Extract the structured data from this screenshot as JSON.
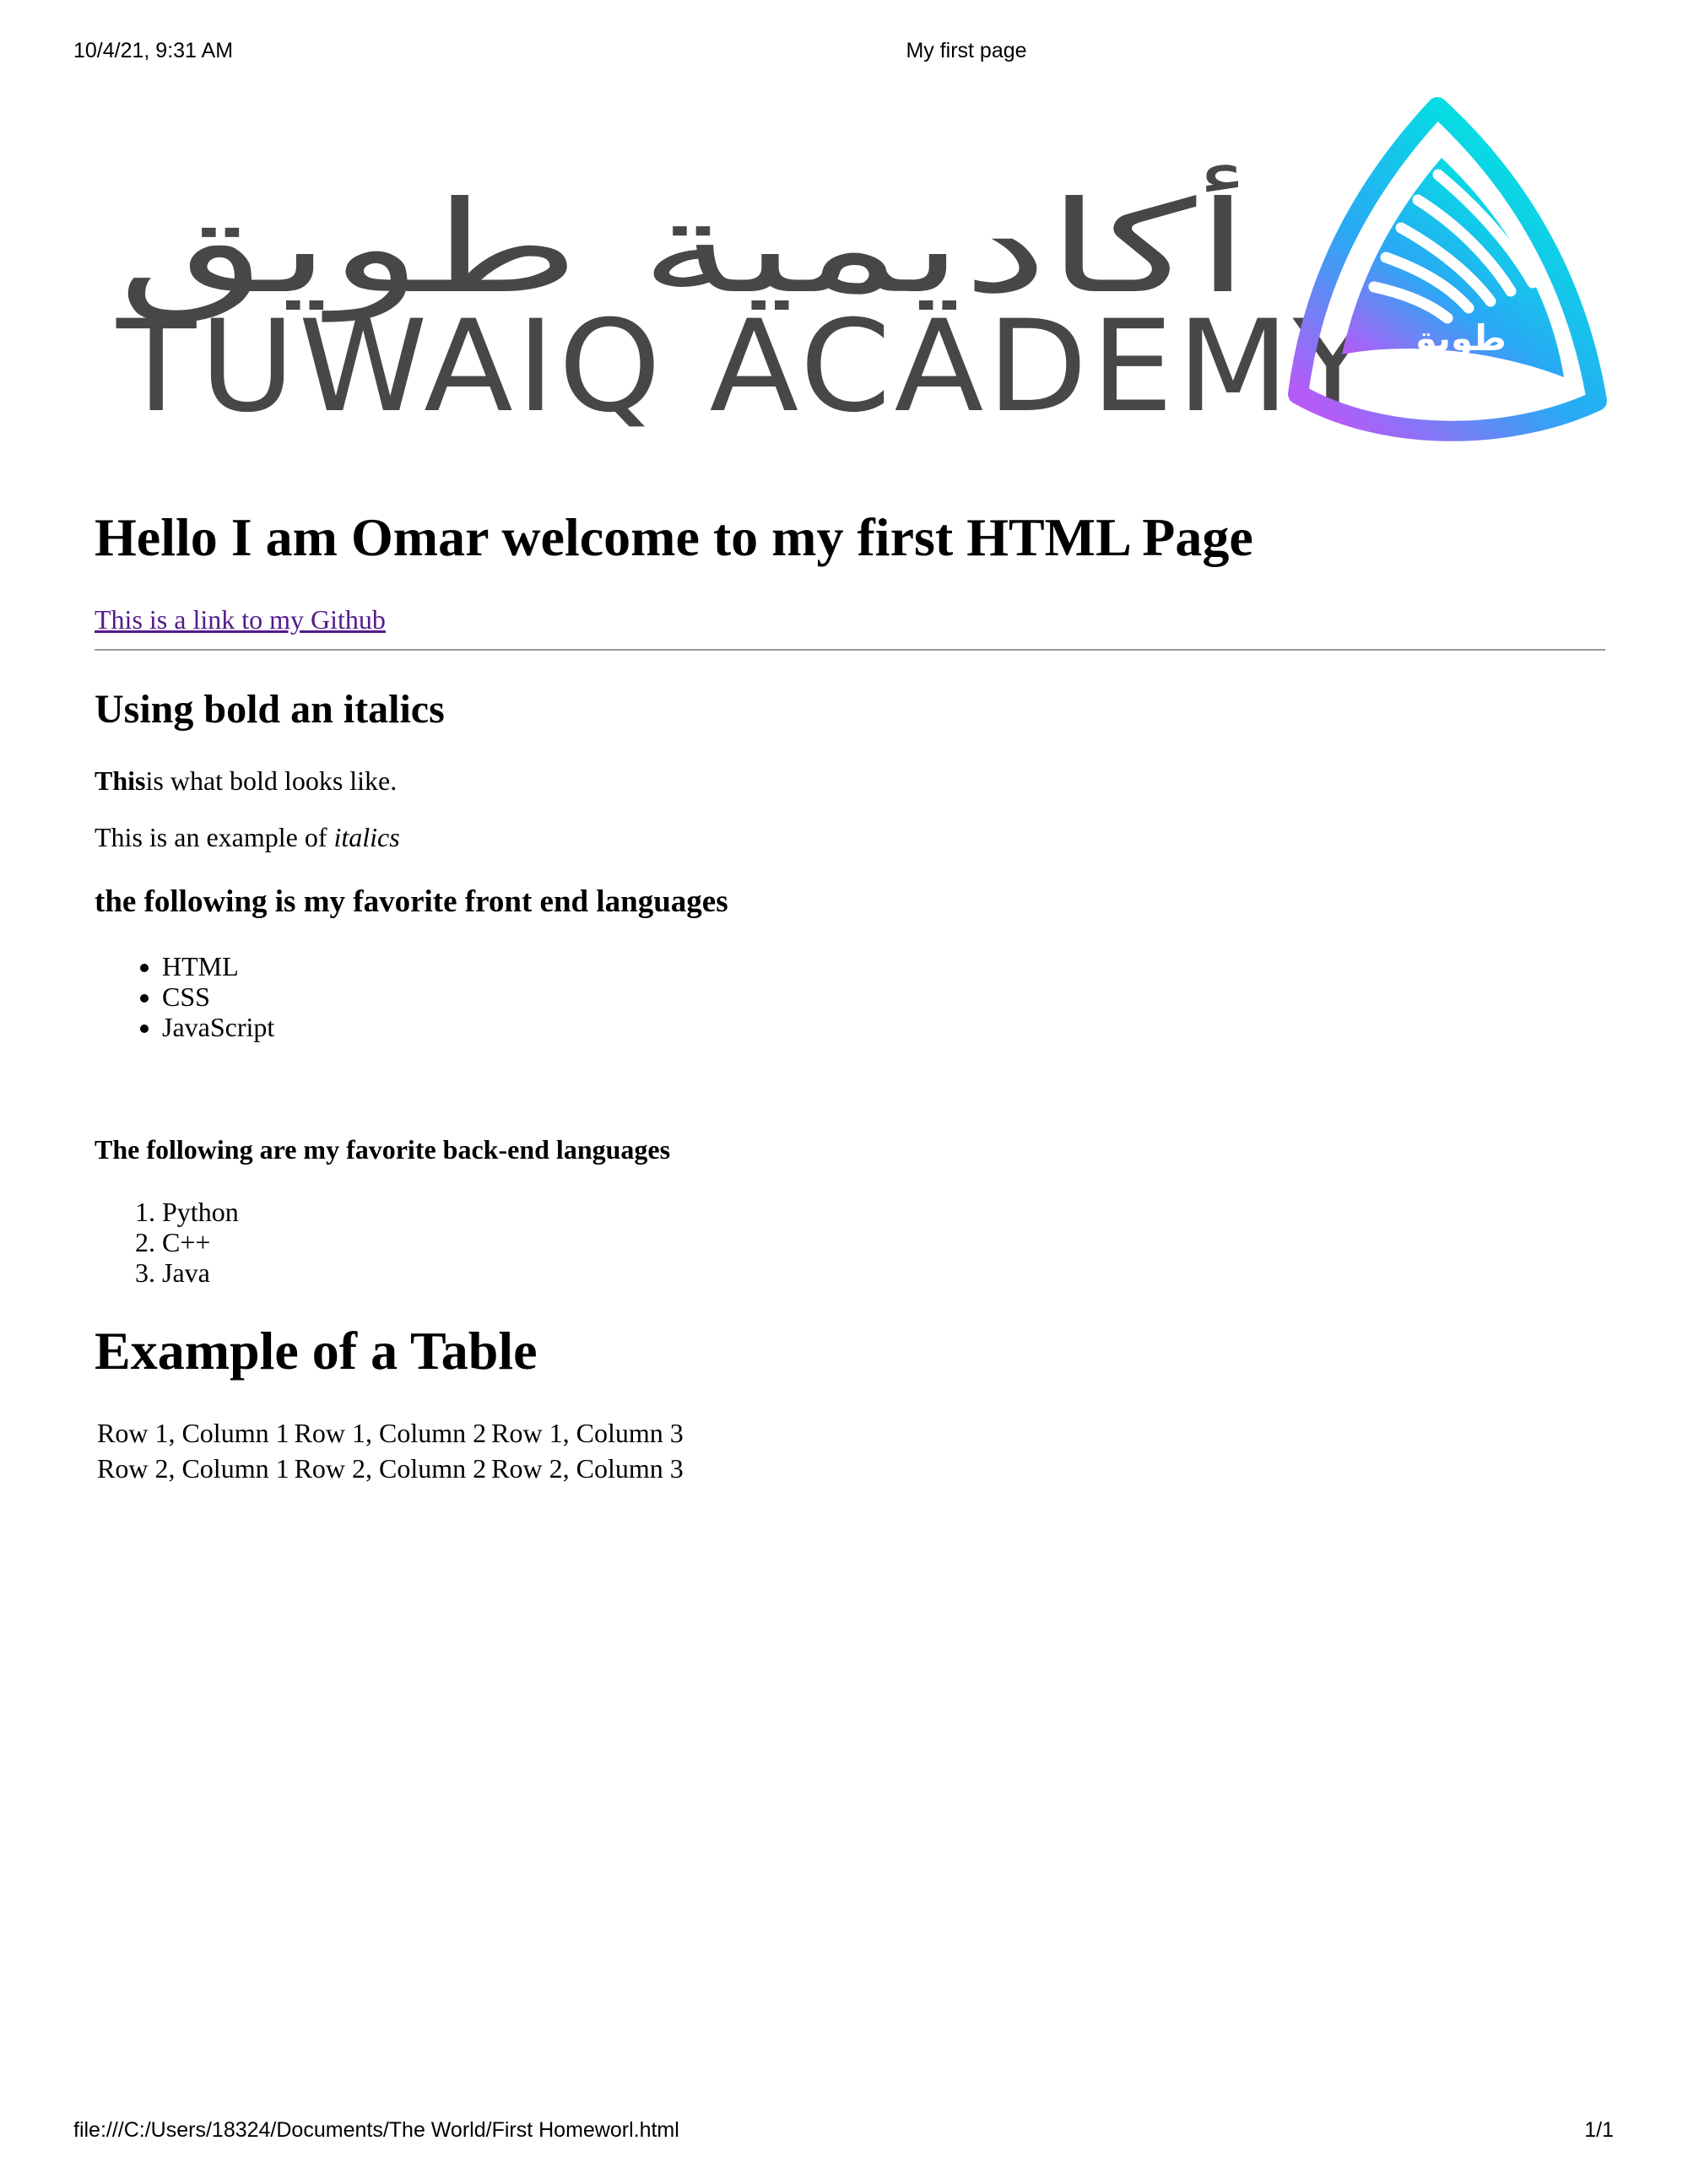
{
  "print_header": {
    "date_time": "10/4/21, 9:31 AM",
    "page_title": "My first page"
  },
  "logo": {
    "arabic_text": "أكاديمية طويق",
    "english_text": "TUWAIQ ACADEMY",
    "emblem_text": "طويق",
    "colors": {
      "wordmark": "#474747",
      "gradient_top": "#00e4e0",
      "gradient_mid": "#2aa8f5",
      "gradient_bottom": "#b45cf6"
    }
  },
  "main_heading": "Hello I am Omar welcome to my first HTML Page",
  "github_link": "This is a link to my Github",
  "bold_section": {
    "heading": "Using bold an italics",
    "bold_word": "This",
    "bold_rest": "is what bold looks like.",
    "italics_prefix": "This is an example of ",
    "italics_word": "italics"
  },
  "front_end": {
    "heading": "the following is my favorite front end languages",
    "items": [
      "HTML",
      "CSS",
      "JavaScript"
    ]
  },
  "back_end": {
    "heading": "The following are my favorite back-end languages",
    "items": [
      "Python",
      "C++",
      "Java"
    ]
  },
  "table_section": {
    "heading": "Example of a Table",
    "rows": [
      [
        "Row 1, Column 1",
        "Row 1, Column 2",
        "Row 1, Column 3"
      ],
      [
        "Row 2, Column 1",
        "Row 2, Column 2",
        "Row 2, Column 3"
      ]
    ]
  },
  "print_footer": {
    "file_path": "file:///C:/Users/18324/Documents/The World/First Homeworl.html",
    "page_number": "1/1"
  }
}
